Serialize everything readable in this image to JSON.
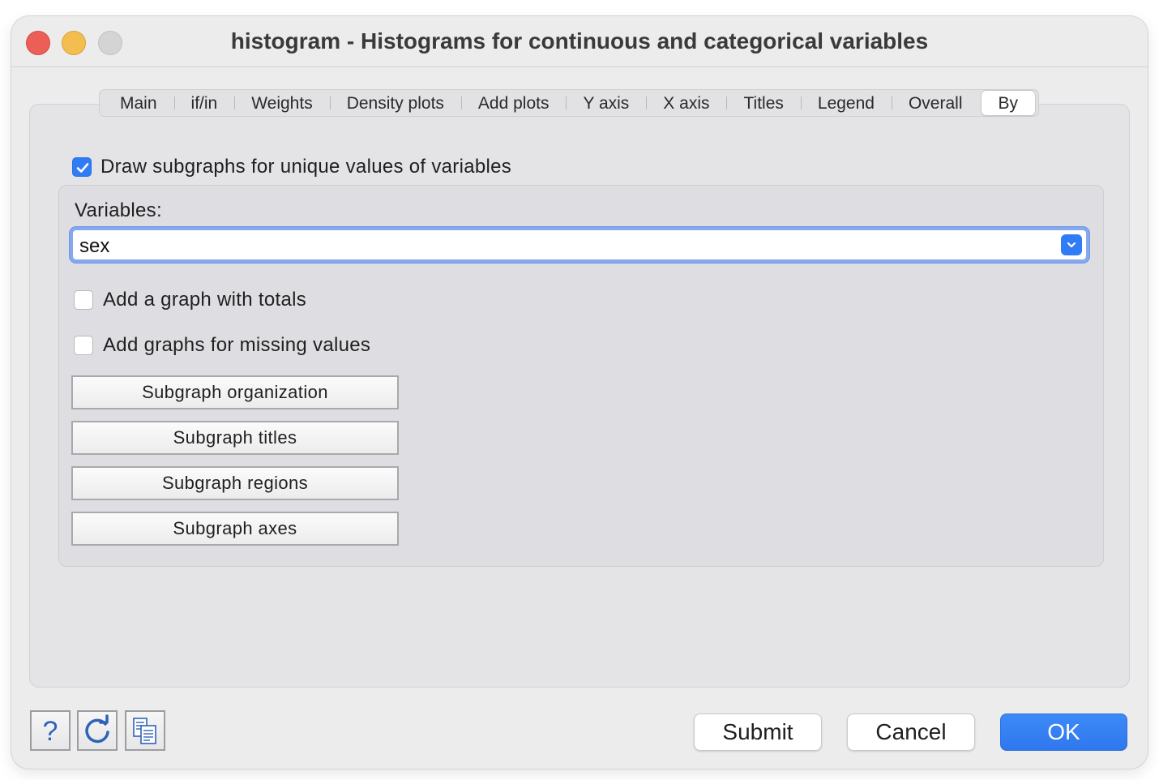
{
  "window": {
    "title": "histogram - Histograms for continuous and categorical variables"
  },
  "tabs": [
    {
      "label": "Main"
    },
    {
      "label": "if/in"
    },
    {
      "label": "Weights"
    },
    {
      "label": "Density plots"
    },
    {
      "label": "Add plots"
    },
    {
      "label": "Y axis"
    },
    {
      "label": "X axis"
    },
    {
      "label": "Titles"
    },
    {
      "label": "Legend"
    },
    {
      "label": "Overall"
    },
    {
      "label": "By",
      "active": true
    }
  ],
  "by": {
    "draw_subgraphs_label": "Draw subgraphs for unique values of variables",
    "draw_subgraphs_checked": true,
    "variables_label": "Variables:",
    "variables_value": "sex",
    "add_totals_label": "Add a graph with totals",
    "add_totals_checked": false,
    "add_missing_label": "Add graphs for missing values",
    "add_missing_checked": false,
    "buttons": {
      "organization": "Subgraph organization",
      "titles": "Subgraph titles",
      "regions": "Subgraph regions",
      "axes": "Subgraph axes"
    }
  },
  "footer": {
    "help_icon": "question-icon",
    "reset_icon": "refresh-icon",
    "copy_icon": "copy-command-icon",
    "submit_label": "Submit",
    "cancel_label": "Cancel",
    "ok_label": "OK"
  },
  "colors": {
    "accent": "#2f7cf6",
    "focus_ring": "#86a9ee"
  }
}
